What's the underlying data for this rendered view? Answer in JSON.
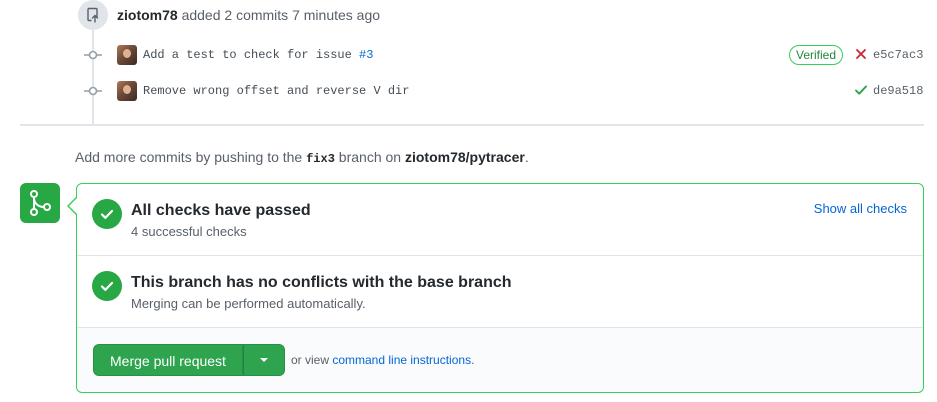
{
  "timeline": {
    "author": "ziotom78",
    "action_text": "added 2 commits",
    "time": "7 minutes ago",
    "commits": [
      {
        "message": "Add a test to check for issue ",
        "issue_link": "#3",
        "verified_label": "Verified",
        "status": "failure",
        "status_icon": "x-icon",
        "sha": "e5c7ac3"
      },
      {
        "message": "Remove wrong offset and reverse V dir",
        "issue_link": "",
        "verified_label": "",
        "status": "success",
        "status_icon": "check-icon",
        "sha": "de9a518"
      }
    ]
  },
  "add_more": {
    "prefix": "Add more commits by pushing to the ",
    "branch": "fix3",
    "middle": " branch on ",
    "repo": "ziotom78/pytracer",
    "suffix": "."
  },
  "merge_box": {
    "checks": {
      "title": "All checks have passed",
      "subtitle": "4 successful checks",
      "show_all_label": "Show all checks"
    },
    "conflicts": {
      "title": "This branch has no conflicts with the base branch",
      "subtitle": "Merging can be performed automatically."
    },
    "footer": {
      "merge_button_label": "Merge pull request",
      "or_view_prefix": "or view ",
      "cli_link": "command line instructions",
      "or_view_suffix": "."
    }
  },
  "colors": {
    "success_green": "#28a745",
    "failure_red": "#cb2431",
    "link_blue": "#0366d6"
  }
}
